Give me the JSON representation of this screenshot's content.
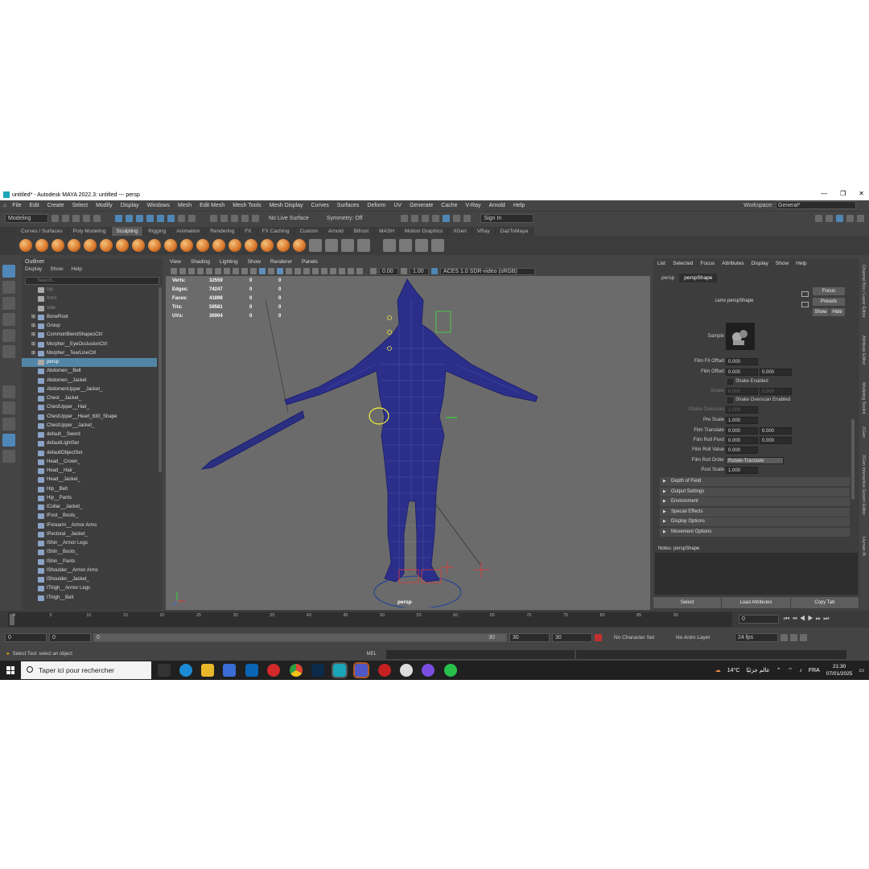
{
  "window": {
    "title": "untitled* - Autodesk MAYA 2022.3: untitled   ---   persp",
    "min": "—",
    "max": "❐",
    "close": "✕"
  },
  "menubar": [
    "File",
    "Edit",
    "Create",
    "Select",
    "Modify",
    "Display",
    "Windows",
    "Mesh",
    "Edit Mesh",
    "Mesh Tools",
    "Mesh Display",
    "Curves",
    "Surfaces",
    "Deform",
    "UV",
    "Generate",
    "Cache",
    "V-Ray",
    "Arnold",
    "Help"
  ],
  "workspace": {
    "label": "Workspace:",
    "value": "General*"
  },
  "statusline": {
    "mode": "Modeling",
    "live_surface": "No Live Surface",
    "symmetry": "Symmetry: Off",
    "sign_in": "Sign In"
  },
  "shelf_tabs": [
    "Curves / Surfaces",
    "Poly Modeling",
    "Sculpting",
    "Rigging",
    "Animation",
    "Rendering",
    "FX",
    "FX Caching",
    "Custom",
    "Arnold",
    "Bifrost",
    "MASH",
    "Motion Graphics",
    "XGen",
    "VRay",
    "DazToMaya"
  ],
  "shelf_active": "Sculpting",
  "outliner": {
    "title": "Outliner",
    "menu": [
      "Display",
      "Show",
      "Help"
    ],
    "search_placeholder": "Search...",
    "items": [
      {
        "name": "top",
        "dim": true
      },
      {
        "name": "front",
        "dim": true
      },
      {
        "name": "side",
        "dim": true
      },
      {
        "name": "BoneRoot"
      },
      {
        "name": "Group"
      },
      {
        "name": "CommonBlendShapesCtrl"
      },
      {
        "name": "Morpher__EyeOcclusionCtrl"
      },
      {
        "name": "Morpher__TearLineCtrl"
      },
      {
        "name": "persp",
        "sel": true
      },
      {
        "name": "Abdomen__Belt"
      },
      {
        "name": "Abdomen__Jacket"
      },
      {
        "name": "AbdomenUpper__Jacket_"
      },
      {
        "name": "Chest__Jacket_"
      },
      {
        "name": "ChestUpper__Hair_"
      },
      {
        "name": "ChestUpper__Heart_630_Shape"
      },
      {
        "name": "ChestUpper__Jacket_"
      },
      {
        "name": "default__Sword"
      },
      {
        "name": "defaultLightSet"
      },
      {
        "name": "defaultObjectSet"
      },
      {
        "name": "Head__Crown_"
      },
      {
        "name": "Head__Hair_"
      },
      {
        "name": "Head__Jacket_"
      },
      {
        "name": "Hip__Belt"
      },
      {
        "name": "Hip__Pants"
      },
      {
        "name": "lCollar__Jacket_"
      },
      {
        "name": "lFoot__Boots_"
      },
      {
        "name": "lForearm__Armor Arms"
      },
      {
        "name": "lPectoral__Jacket_"
      },
      {
        "name": "lShin__Armor Legs"
      },
      {
        "name": "lShin__Boots_"
      },
      {
        "name": "lShin__Pants"
      },
      {
        "name": "lShoulder__Armor Arms"
      },
      {
        "name": "lShoulder__Jacket_"
      },
      {
        "name": "lThigh__Armor Legs"
      },
      {
        "name": "lThigh__Belt"
      }
    ]
  },
  "viewport": {
    "menu": [
      "View",
      "Shading",
      "Lighting",
      "Show",
      "Renderer",
      "Panels"
    ],
    "exposure": "0.00",
    "gamma": "1.00",
    "colorspace": "ACES 1.0 SDR-video (sRGB)",
    "hud": [
      {
        "k": "Verts:",
        "a": "32559",
        "b": "0",
        "c": "0"
      },
      {
        "k": "Edges:",
        "a": "74247",
        "b": "0",
        "c": "0"
      },
      {
        "k": "Faces:",
        "a": "41898",
        "b": "0",
        "c": "0"
      },
      {
        "k": "Tris:",
        "a": "59581",
        "b": "0",
        "c": "0"
      },
      {
        "k": "UVs:",
        "a": "36904",
        "b": "0",
        "c": "0"
      }
    ],
    "camera": "persp"
  },
  "attr": {
    "menu": [
      "List",
      "Selected",
      "Focus",
      "Attributes",
      "Display",
      "Show",
      "Help"
    ],
    "tabs": [
      "persp",
      "perspShape"
    ],
    "camera_label": "camera:",
    "camera_value": "perspShape",
    "focus": "Focus",
    "presets": "Presets",
    "show": "Show",
    "hide": "Hide",
    "sample": "Sample",
    "film_fit_offset": {
      "label": "Film Fit Offset",
      "v": "0.000"
    },
    "film_offset": {
      "label": "Film Offset",
      "v1": "0.000",
      "v2": "0.000"
    },
    "shake_enabled": "Shake Enabled",
    "shake": {
      "label": "Shake",
      "v1": "0.000",
      "v2": "0.000"
    },
    "shake_overscan_enabled": "Shake Overscan Enabled",
    "shake_overscan": {
      "label": "Shake Overscan",
      "v": "1.000"
    },
    "pre_scale": {
      "label": "Pre Scale",
      "v": "1.000"
    },
    "film_translate": {
      "label": "Film Translate",
      "v1": "0.000",
      "v2": "0.000"
    },
    "film_roll_pivot": {
      "label": "Film Roll Pivot",
      "v1": "0.000",
      "v2": "0.000"
    },
    "film_roll_value": {
      "label": "Film Roll Value",
      "v": "0.000"
    },
    "film_roll_order": {
      "label": "Film Roll Order",
      "v": "Rotate-Translate"
    },
    "post_scale": {
      "label": "Post Scale",
      "v": "1.000"
    },
    "sections": [
      "Depth of Field",
      "Output Settings",
      "Environment",
      "Special Effects",
      "Display Options",
      "Movement Options"
    ],
    "notes": "Notes:  perspShape",
    "bottom": [
      "Select",
      "Load Attributes",
      "Copy Tab"
    ]
  },
  "sidetabs": [
    "Channel Box / Layer Editor",
    "Attribute Editor",
    "Modeling Toolkit",
    "XGen",
    "XGen Interactive Groom Editor",
    "Human IK"
  ],
  "timeline": {
    "ticks": [
      "0",
      "5",
      "10",
      "15",
      "20",
      "25",
      "30",
      "35",
      "40",
      "45",
      "50",
      "55",
      "60",
      "65",
      "70",
      "75",
      "80",
      "85",
      "90",
      "95",
      "100",
      "105",
      "110",
      "115",
      "120",
      "125",
      "130",
      "135",
      "140",
      "145",
      "150"
    ],
    "current": "0"
  },
  "range": {
    "start": "0",
    "inner_start": "0",
    "slider_start": "0",
    "slider_end": "30",
    "end": "30",
    "anim_end": "30",
    "charset": "No Character Set",
    "animlayer": "No Anim Layer",
    "fps": "24 fps"
  },
  "cmd": {
    "lang": "MEL",
    "help": "Select Tool: select an object"
  },
  "taskbar": {
    "search": "Taper ici pour rechercher",
    "weather": "14°C",
    "weather_text": "عالم جزئيًا",
    "lang": "FRA",
    "time": "21:30",
    "date": "07/01/2025"
  },
  "colors": {
    "accent": "#5285a6",
    "maya": "#1aa5b8"
  }
}
